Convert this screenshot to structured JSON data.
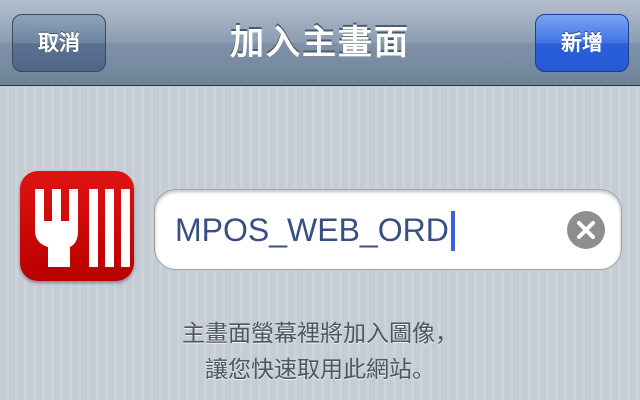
{
  "navbar": {
    "title": "加入主畫面",
    "cancel_label": "取消",
    "add_label": "新增"
  },
  "app_icon": {
    "icon": "fork-icon",
    "background_color": "#cc0000"
  },
  "name_field": {
    "value": "MPOS_WEB_ORD",
    "clear_icon": "clear-icon"
  },
  "hint": {
    "line1": "主畫面螢幕裡將加入圖像，",
    "line2": "讓您快速取用此網站。"
  },
  "colors": {
    "navbar": "#8c9db2",
    "add_button": "#2a5fdc",
    "field_text": "#384f83",
    "caret": "#3a5fd8"
  }
}
